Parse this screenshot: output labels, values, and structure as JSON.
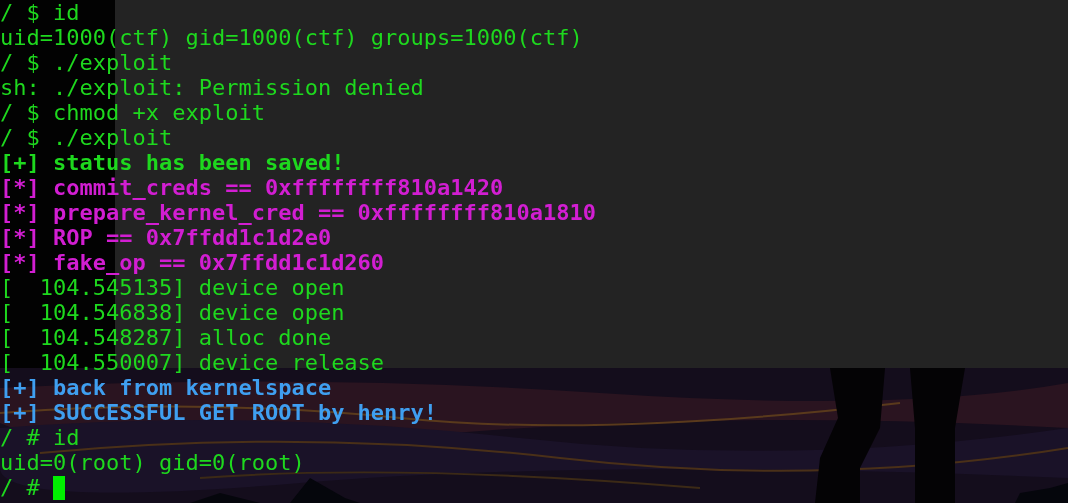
{
  "terminal": {
    "lines": [
      {
        "kind": "normal",
        "text": "/ $ id"
      },
      {
        "kind": "normal",
        "text": "uid=1000(ctf) gid=1000(ctf) groups=1000(ctf)"
      },
      {
        "kind": "normal",
        "text": "/ $ ./exploit"
      },
      {
        "kind": "normal",
        "text": "sh: ./exploit: Permission denied"
      },
      {
        "kind": "normal",
        "text": "/ $ chmod +x exploit"
      },
      {
        "kind": "normal",
        "text": "/ $ ./exploit"
      },
      {
        "kind": "success",
        "text": "[+] status has been saved!"
      },
      {
        "kind": "info",
        "text": "[*] commit_creds == 0xffffffff810a1420"
      },
      {
        "kind": "info",
        "text": "[*] prepare_kernel_cred == 0xffffffff810a1810"
      },
      {
        "kind": "info",
        "text": "[*] ROP == 0x7ffdd1c1d2e0"
      },
      {
        "kind": "info",
        "text": "[*] fake_op == 0x7ffdd1c1d260"
      },
      {
        "kind": "normal",
        "text": "[  104.545135] device open"
      },
      {
        "kind": "normal",
        "text": "[  104.546838] device open"
      },
      {
        "kind": "normal",
        "text": "[  104.548287] alloc done"
      },
      {
        "kind": "normal",
        "text": "[  104.550007] device release"
      },
      {
        "kind": "result",
        "text": "[+] back from kernelspace"
      },
      {
        "kind": "result",
        "text": "[+] SUCCESSFUL GET ROOT by henry!"
      },
      {
        "kind": "normal",
        "text": "/ # id"
      },
      {
        "kind": "normal",
        "text": "uid=0(root) gid=0(root)"
      }
    ],
    "prompt": {
      "text": "/ #"
    }
  }
}
